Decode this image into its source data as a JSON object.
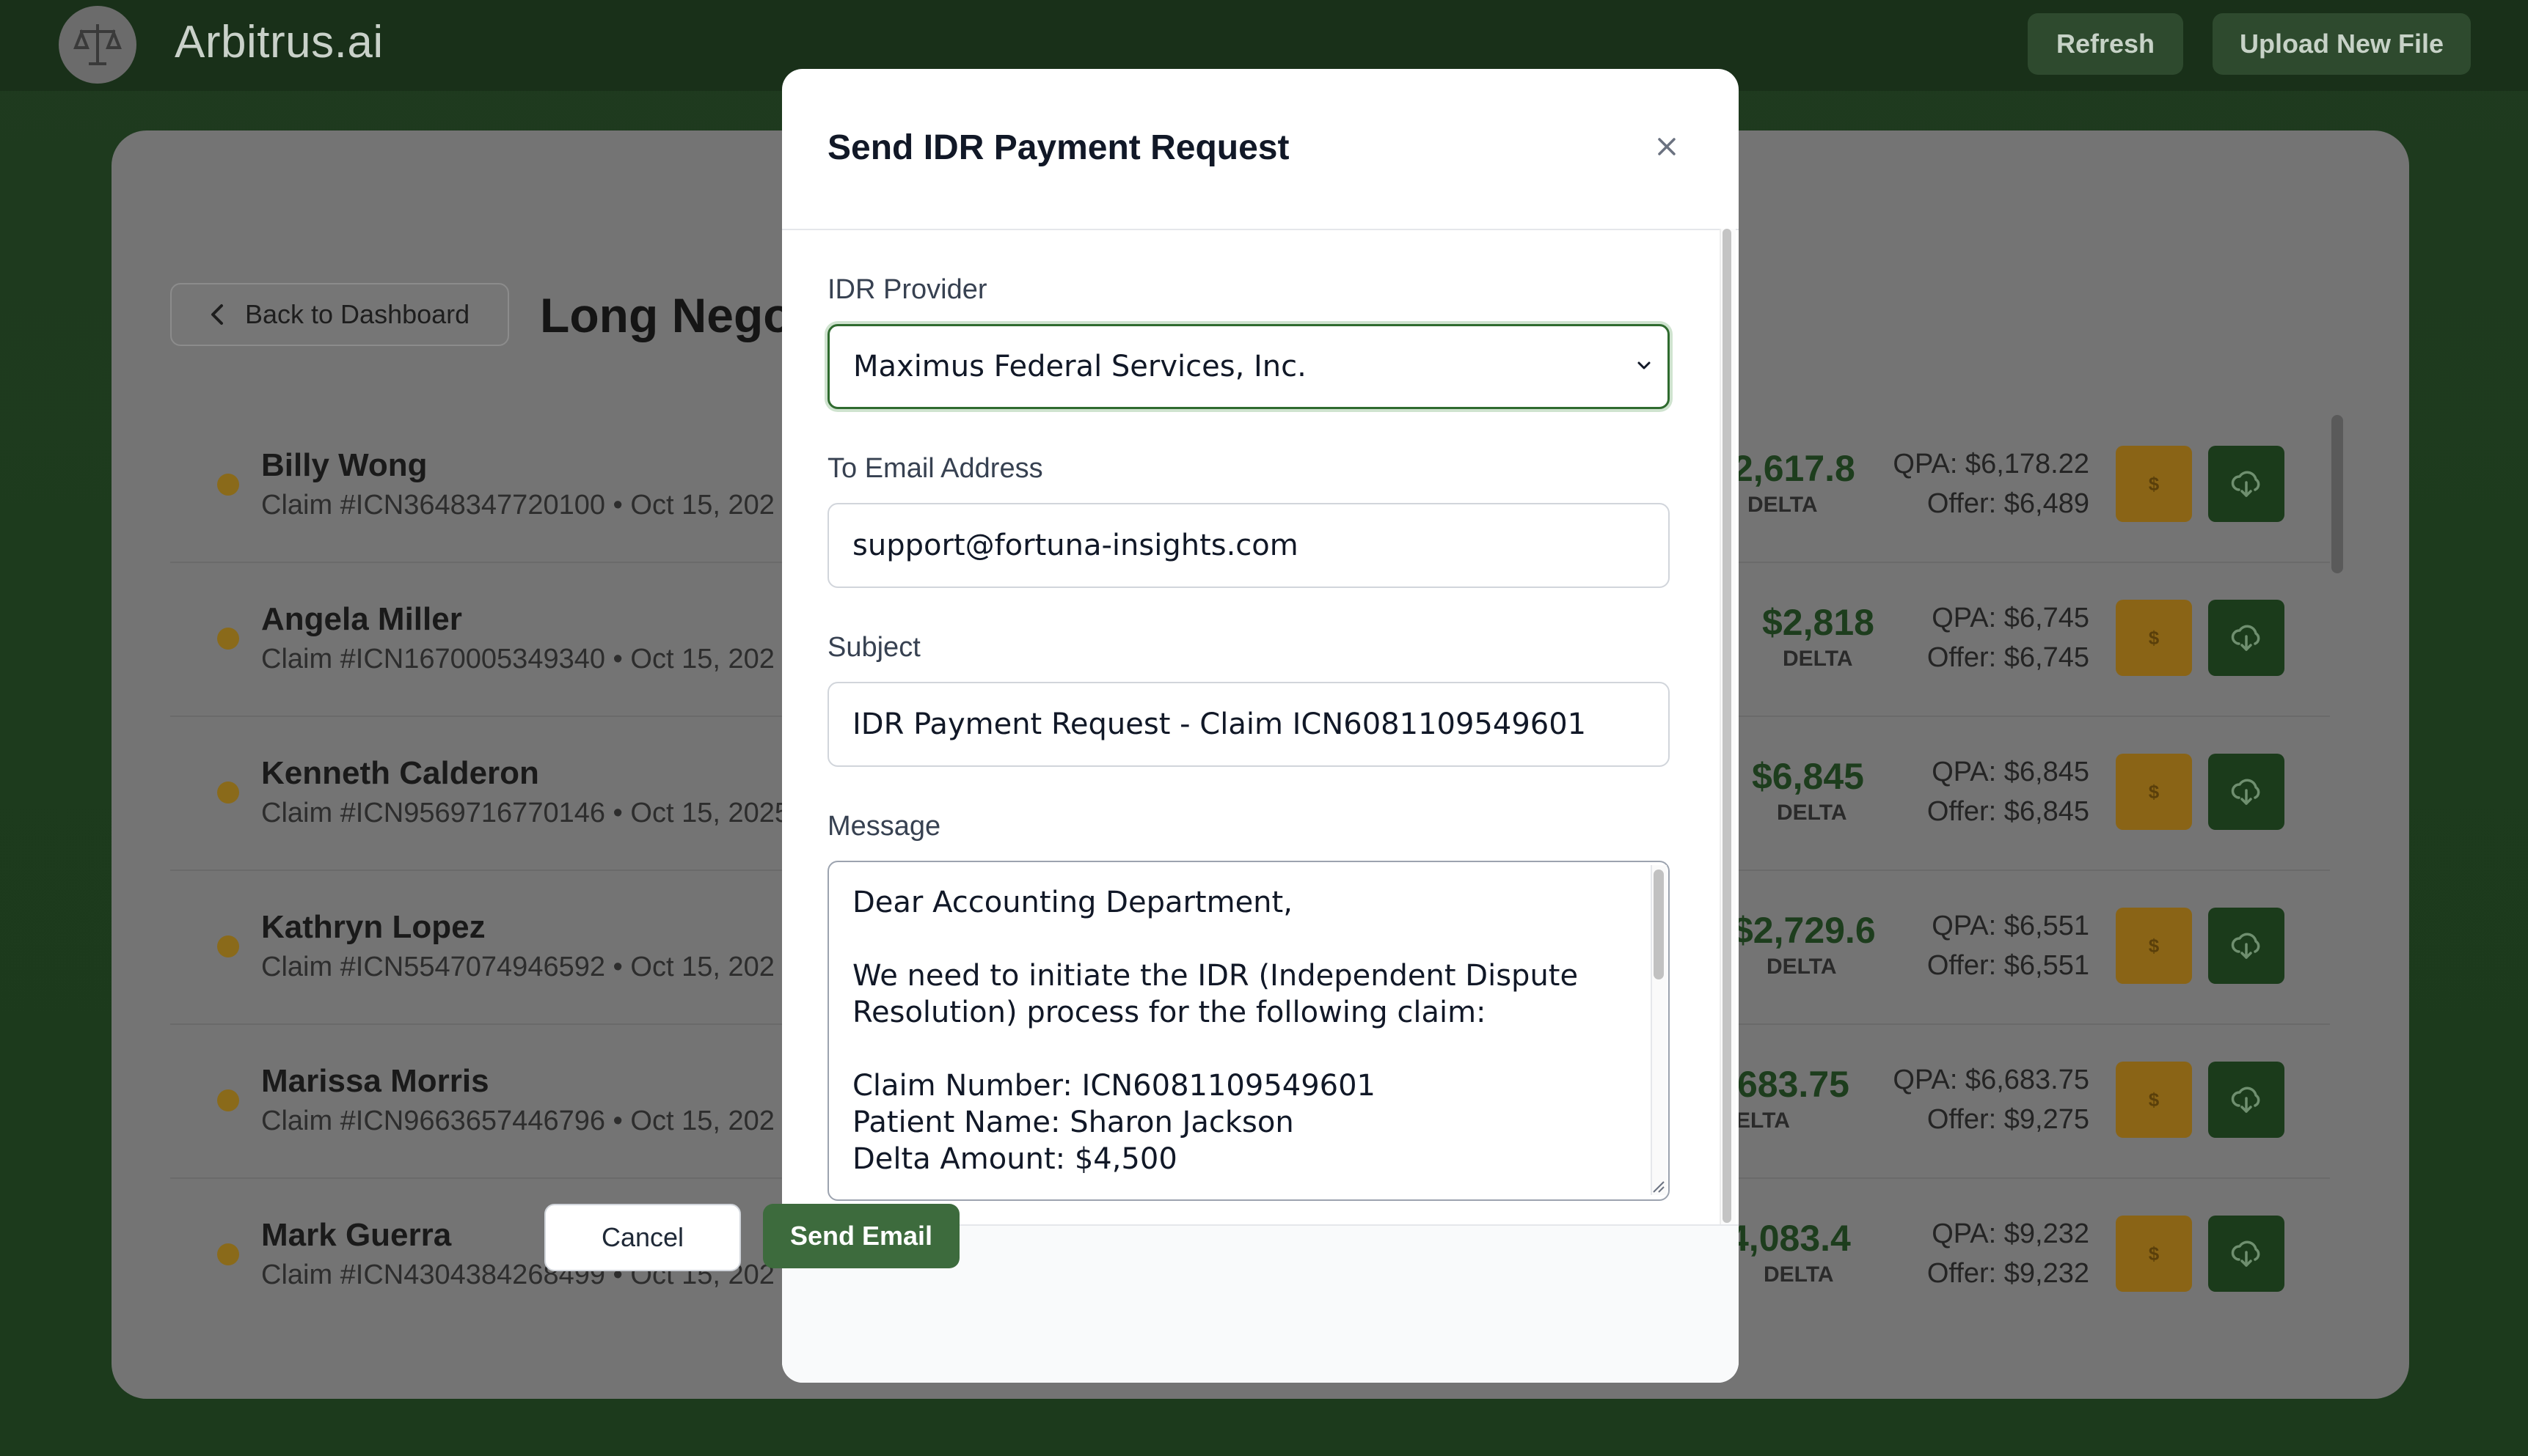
{
  "app": {
    "brand": "Arbitrus.ai"
  },
  "header": {
    "refresh_label": "Refresh",
    "upload_label": "Upload New File"
  },
  "page": {
    "back_label": "Back to Dashboard",
    "title": "Long Negot"
  },
  "claims": [
    {
      "name": "Billy Wong",
      "claim": "Claim #ICN3648347720100 • Oct 15, 202",
      "delta": "2,617.8",
      "delta_label": "DELTA",
      "qpa": "QPA: $6,178.22",
      "offer": "Offer: $6,489"
    },
    {
      "name": "Angela Miller",
      "claim": "Claim #ICN1670005349340 • Oct 15, 202",
      "delta": "$2,818",
      "delta_label": "DELTA",
      "qpa": "QPA: $6,745",
      "offer": "Offer: $6,745"
    },
    {
      "name": "Kenneth Calderon",
      "claim": "Claim #ICN9569716770146 • Oct 15, 2025",
      "delta": "$6,845",
      "delta_label": "DELTA",
      "qpa": "QPA: $6,845",
      "offer": "Offer: $6,845"
    },
    {
      "name": "Kathryn Lopez",
      "claim": "Claim #ICN5547074946592 • Oct 15, 202",
      "delta": "$2,729.6",
      "delta_label": "DELTA",
      "qpa": "QPA: $6,551",
      "offer": "Offer: $6,551"
    },
    {
      "name": "Marissa Morris",
      "claim": "Claim #ICN9663657446796 • Oct 15, 202",
      "delta": "683.75",
      "delta_label": "ELTA",
      "qpa": "QPA: $6,683.75",
      "offer": "Offer: $9,275"
    },
    {
      "name": "Mark Guerra",
      "claim": "Claim #ICN4304384268499 • Oct 15, 202",
      "delta": "4,083.4",
      "delta_label": "DELTA",
      "qpa": "QPA: $9,232",
      "offer": "Offer: $9,232"
    }
  ],
  "row_button": {
    "dollar": "$"
  },
  "modal": {
    "title": "Send IDR Payment Request",
    "provider_label": "IDR Provider",
    "provider_value": "Maximus Federal Services, Inc.",
    "email_label": "To Email Address",
    "email_value": "support@fortuna-insights.com",
    "subject_label": "Subject",
    "subject_value": "IDR Payment Request - Claim ICN6081109549601",
    "message_label": "Message",
    "message_value": "Dear Accounting Department,\n\nWe need to initiate the IDR (Independent Dispute\nResolution) process for the following claim:\n\nClaim Number: ICN6081109549601\nPatient Name: Sharon Jackson\nDelta Amount: $4,500",
    "cancel_label": "Cancel",
    "send_label": "Send Email"
  },
  "colors": {
    "accent": "#3d6b3d",
    "gold": "#d08f1c",
    "dark_green": "#2f5a2f"
  },
  "icons": [
    "logo-scales-icon",
    "chevron-left-icon",
    "close-icon",
    "chevron-down-icon",
    "dollar-icon",
    "cloud-download-icon"
  ]
}
